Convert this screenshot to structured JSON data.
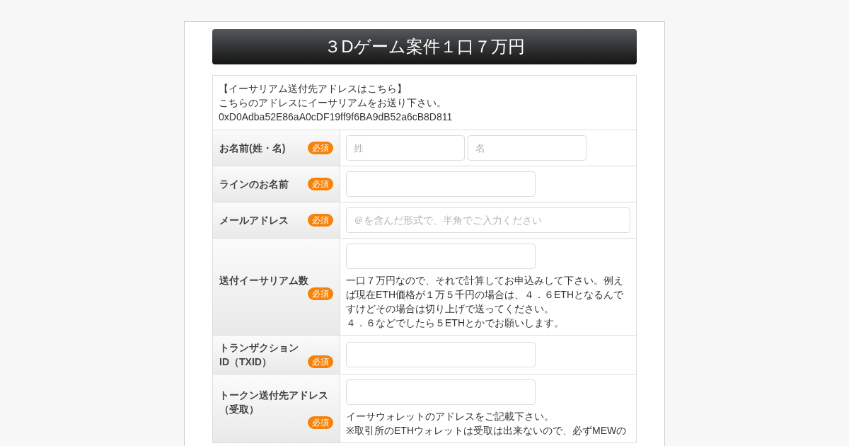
{
  "title": "３Dゲーム案件１口７万円",
  "intro": {
    "heading": "【イーサリアム送付先アドレスはこちら】",
    "text": "こちらのアドレスにイーサリアムをお送り下さい。",
    "address": "0xD0Adba52E86aA0cDF19ff9f6BA9dB52a6cB8D811"
  },
  "fields": [
    {
      "kind": "name_pair",
      "label_lines": [
        "お名前(姓・名)"
      ],
      "badge": "必須",
      "placeholders": [
        "姓",
        "名"
      ]
    },
    {
      "kind": "text",
      "label_lines": [
        "ラインのお名前"
      ],
      "badge": "必須"
    },
    {
      "kind": "email",
      "label_lines": [
        "メールアドレス"
      ],
      "badge": "必須",
      "placeholders": [
        "＠を含んだ形式で、半角でご入力ください"
      ]
    },
    {
      "kind": "text",
      "label_lines": [
        "送付イーサリアム数"
      ],
      "badge": "必須",
      "note_lines": [
        "一口７万円なので、それで計算してお申込みして下さい。例えば現在ETH価格が１万５千円の場合は、４．６ETHとなるんですけどその場合は切り上げで送ってください。",
        "４．６などでしたら５ETHとかでお願いします。"
      ]
    },
    {
      "kind": "text",
      "label_lines": [
        "トランザクション",
        "ID（TXID）"
      ],
      "badge": "必須"
    },
    {
      "kind": "text",
      "label_lines": [
        "トークン送付先アドレス",
        "（受取）"
      ],
      "badge": "必須",
      "note_lines": [
        "イーサウォレットのアドレスをご記載下さい。",
        "※取引所のETHウォレットは受取は出来ないので、必ずMEWの"
      ]
    }
  ]
}
